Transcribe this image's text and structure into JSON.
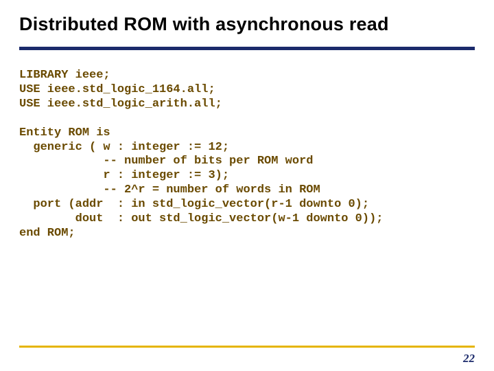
{
  "slide": {
    "title": "Distributed ROM with asynchronous read",
    "code": "LIBRARY ieee;\nUSE ieee.std_logic_1164.all;\nUSE ieee.std_logic_arith.all;\n\nEntity ROM is\n  generic ( w : integer := 12;\n            -- number of bits per ROM word\n            r : integer := 3);\n            -- 2^r = number of words in ROM\n  port (addr  : in std_logic_vector(r-1 downto 0);\n        dout  : out std_logic_vector(w-1 downto 0));\nend ROM;",
    "page_number": "22"
  }
}
